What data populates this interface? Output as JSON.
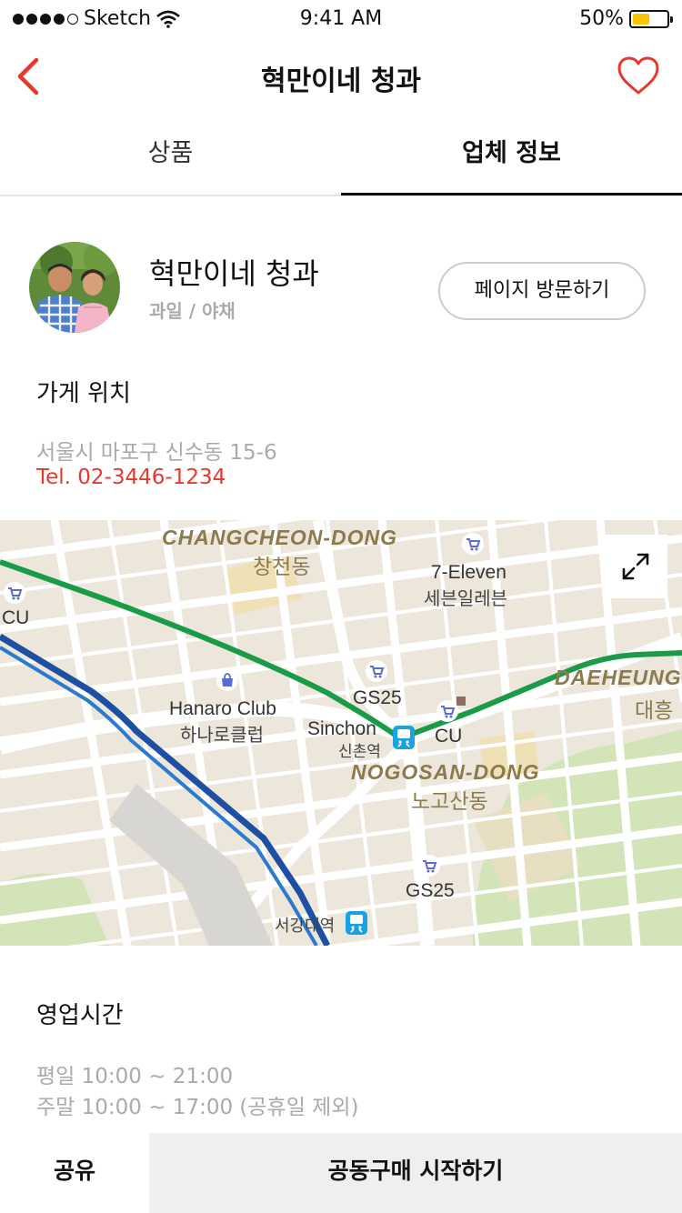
{
  "status_bar": {
    "carrier": "Sketch",
    "time": "9:41 AM",
    "battery_percent": "50%",
    "battery_level": 0.5
  },
  "nav": {
    "title": "혁만이네 청과",
    "back_icon": "chevron-left-icon",
    "favorite_icon": "heart-outline-icon",
    "accent_color": "#e8382b"
  },
  "tabs": [
    {
      "label": "상품",
      "active": false
    },
    {
      "label": "업체 정보",
      "active": true
    }
  ],
  "shop": {
    "name": "혁만이네 청과",
    "category": "과일 / 야채",
    "visit_button": "페이지 방문하기"
  },
  "location": {
    "title": "가게 위치",
    "address": "서울시 마포구 신수동 15-6",
    "tel": "Tel. 02-3446-1234"
  },
  "map": {
    "districts": [
      {
        "en": "CHANGCHEON-DONG",
        "ko": "창천동"
      },
      {
        "en": "DAEHEUNG",
        "ko": "대흥"
      },
      {
        "en": "NOGOSAN-DONG",
        "ko": "노고산동"
      }
    ],
    "pois": [
      {
        "en": "7-Eleven",
        "ko": "세븐일레븐"
      },
      {
        "en": "CU"
      },
      {
        "en": "GS25"
      },
      {
        "en": "Hanaro Club",
        "ko": "하나로클럽"
      },
      {
        "en": "Sinchon",
        "ko": "신촌역"
      },
      {
        "en": "CU"
      },
      {
        "en": "GS25"
      },
      {
        "ko": "서강대역"
      }
    ],
    "expand_icon": "expand-icon"
  },
  "hours": {
    "title": "영업시간",
    "weekday": "평일 10:00 ~ 21:00",
    "weekend": "주말 10:00 ~ 17:00 (공휴일 제외)"
  },
  "bottom": {
    "share": "공유",
    "start": "공동구매 시작하기"
  }
}
